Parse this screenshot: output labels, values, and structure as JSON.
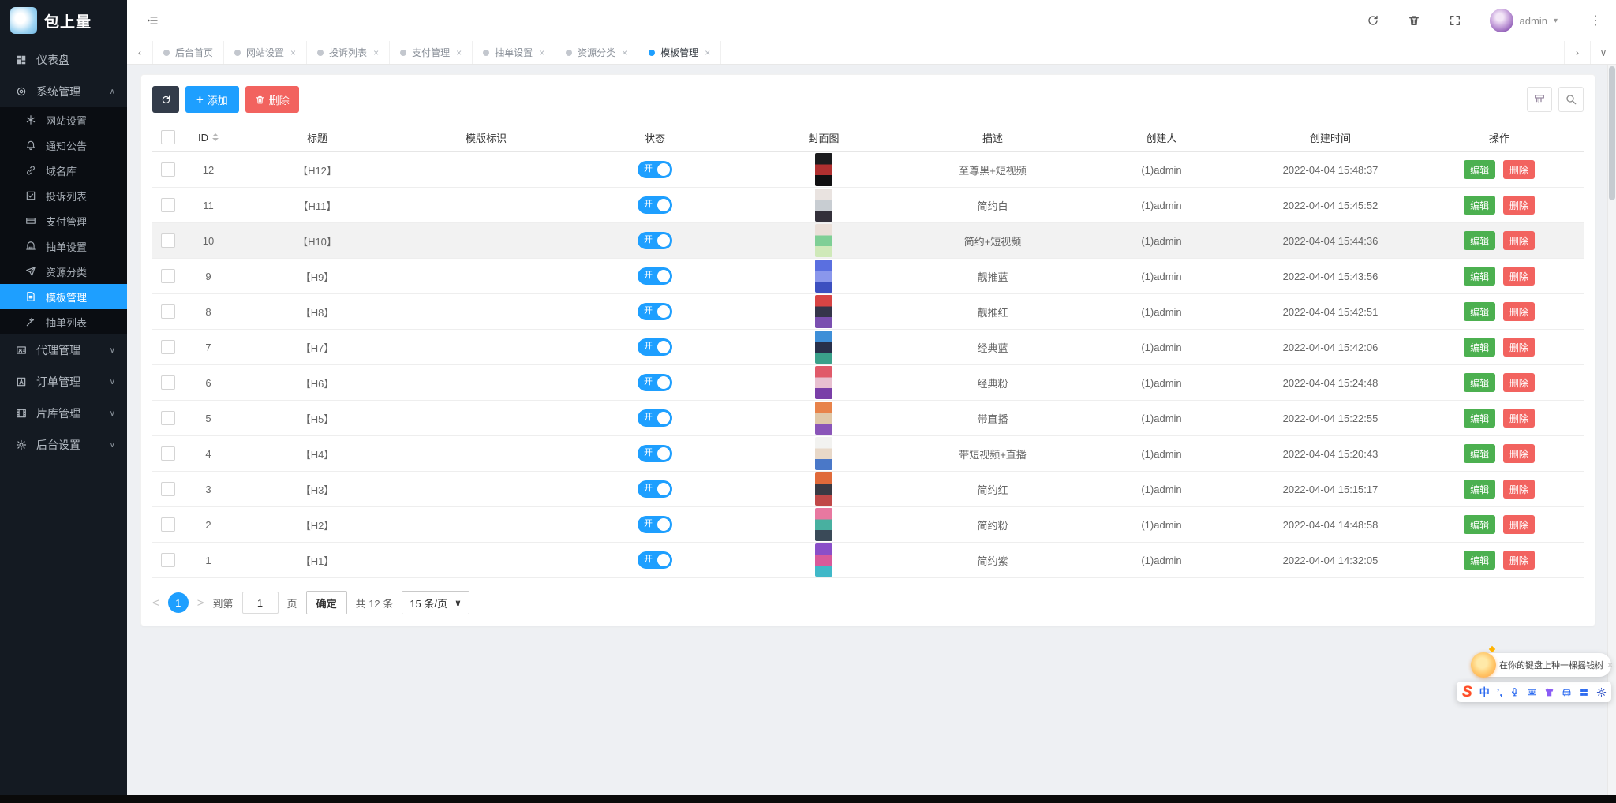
{
  "app": {
    "title": "包上量"
  },
  "topbar": {
    "username": "admin",
    "caret": "▾",
    "dots": "⋮"
  },
  "tabbar": {
    "prev": "‹",
    "next": "›",
    "collapse": "∨",
    "close_glyph": "×",
    "tabs": [
      {
        "label": "后台首页",
        "closable": false,
        "active": false
      },
      {
        "label": "网站设置",
        "closable": true,
        "active": false
      },
      {
        "label": "投诉列表",
        "closable": true,
        "active": false
      },
      {
        "label": "支付管理",
        "closable": true,
        "active": false
      },
      {
        "label": "抽单设置",
        "closable": true,
        "active": false
      },
      {
        "label": "资源分类",
        "closable": true,
        "active": false
      },
      {
        "label": "模板管理",
        "closable": true,
        "active": true
      }
    ]
  },
  "sidebar": {
    "items": [
      {
        "name": "dashboard",
        "label": "仪表盘",
        "icon": "dashboard",
        "type": "top"
      },
      {
        "name": "system-management",
        "label": "系统管理",
        "icon": "system",
        "type": "top",
        "chevron": "∧"
      },
      {
        "name": "website-settings",
        "label": "网站设置",
        "icon": "website",
        "type": "sub"
      },
      {
        "name": "notice",
        "label": "通知公告",
        "icon": "bell",
        "type": "sub"
      },
      {
        "name": "domain-library",
        "label": "域名库",
        "icon": "link",
        "type": "sub"
      },
      {
        "name": "complaint-list",
        "label": "投诉列表",
        "icon": "complaint",
        "type": "sub"
      },
      {
        "name": "payment-management",
        "label": "支付管理",
        "icon": "payment",
        "type": "sub"
      },
      {
        "name": "draw-settings",
        "label": "抽单设置",
        "icon": "draw",
        "type": "sub"
      },
      {
        "name": "resource-category",
        "label": "资源分类",
        "icon": "resource",
        "type": "sub"
      },
      {
        "name": "template-management",
        "label": "模板管理",
        "icon": "template",
        "type": "sub",
        "active": true
      },
      {
        "name": "draw-list",
        "label": "抽单列表",
        "icon": "wand",
        "type": "sub"
      },
      {
        "name": "agent-management",
        "label": "代理管理",
        "icon": "agent",
        "type": "top",
        "chevron": "∨"
      },
      {
        "name": "order-management",
        "label": "订单管理",
        "icon": "order",
        "type": "top",
        "chevron": "∨"
      },
      {
        "name": "media-library",
        "label": "片库管理",
        "icon": "film",
        "type": "top",
        "chevron": "∨"
      },
      {
        "name": "backend-settings",
        "label": "后台设置",
        "icon": "gears",
        "type": "top",
        "chevron": "∨"
      }
    ]
  },
  "toolbar": {
    "add_plus": "+",
    "add_label": "添加",
    "delete_label": "删除"
  },
  "table": {
    "columns": [
      "",
      "ID",
      "标题",
      "模版标识",
      "状态",
      "封面图",
      "描述",
      "创建人",
      "创建时间",
      "操作"
    ],
    "actions": {
      "edit": "编辑",
      "delete": "删除"
    },
    "rows": [
      {
        "id": "12",
        "title": "【H12】",
        "template_key": "",
        "status": "开",
        "desc": "至尊黑+短视频",
        "creator": "(1)admin",
        "created": "2022-04-04 15:48:37",
        "cover": [
          "#1c1c1e",
          "#b03030",
          "#101012"
        ],
        "highlighted": false
      },
      {
        "id": "11",
        "title": "【H11】",
        "template_key": "",
        "status": "开",
        "desc": "简约白",
        "creator": "(1)admin",
        "created": "2022-04-04 15:45:52",
        "cover": [
          "#e9e3e0",
          "#c8cdd2",
          "#33303a"
        ],
        "highlighted": false
      },
      {
        "id": "10",
        "title": "【H10】",
        "template_key": "",
        "status": "开",
        "desc": "简约+短视频",
        "creator": "(1)admin",
        "created": "2022-04-04 15:44:36",
        "cover": [
          "#eadfd8",
          "#7fcf96",
          "#cfe9b9"
        ],
        "highlighted": true
      },
      {
        "id": "9",
        "title": "【H9】",
        "template_key": "",
        "status": "开",
        "desc": "靓推蓝",
        "creator": "(1)admin",
        "created": "2022-04-04 15:43:56",
        "cover": [
          "#5a6fe0",
          "#8a97ec",
          "#3c4fc0"
        ],
        "highlighted": false
      },
      {
        "id": "8",
        "title": "【H8】",
        "template_key": "",
        "status": "开",
        "desc": "靓推红",
        "creator": "(1)admin",
        "created": "2022-04-04 15:42:51",
        "cover": [
          "#d84444",
          "#35354a",
          "#7a4fb0"
        ],
        "highlighted": false
      },
      {
        "id": "7",
        "title": "【H7】",
        "template_key": "",
        "status": "开",
        "desc": "经典蓝",
        "creator": "(1)admin",
        "created": "2022-04-04 15:42:06",
        "cover": [
          "#3e8fd8",
          "#28304a",
          "#3aa08a"
        ],
        "highlighted": false
      },
      {
        "id": "6",
        "title": "【H6】",
        "template_key": "",
        "status": "开",
        "desc": "经典粉",
        "creator": "(1)admin",
        "created": "2022-04-04 15:24:48",
        "cover": [
          "#e05a6a",
          "#e8c0d0",
          "#7a3fa8"
        ],
        "highlighted": false
      },
      {
        "id": "5",
        "title": "【H5】",
        "template_key": "",
        "status": "开",
        "desc": "带直播",
        "creator": "(1)admin",
        "created": "2022-04-04 15:22:55",
        "cover": [
          "#e8834a",
          "#e0c8a8",
          "#8a55b8"
        ],
        "highlighted": false
      },
      {
        "id": "4",
        "title": "【H4】",
        "template_key": "",
        "status": "开",
        "desc": "带短视频+直播",
        "creator": "(1)admin",
        "created": "2022-04-04 15:20:43",
        "cover": [
          "#f2f2f0",
          "#e8d8c8",
          "#4a78c8"
        ],
        "highlighted": false
      },
      {
        "id": "3",
        "title": "【H3】",
        "template_key": "",
        "status": "开",
        "desc": "简约红",
        "creator": "(1)admin",
        "created": "2022-04-04 15:15:17",
        "cover": [
          "#e06a3a",
          "#3a3a44",
          "#c04848"
        ],
        "highlighted": false
      },
      {
        "id": "2",
        "title": "【H2】",
        "template_key": "",
        "status": "开",
        "desc": "简约粉",
        "creator": "(1)admin",
        "created": "2022-04-04 14:48:58",
        "cover": [
          "#e878a0",
          "#48b0a0",
          "#3a4a58"
        ],
        "highlighted": false
      },
      {
        "id": "1",
        "title": "【H1】",
        "template_key": "",
        "status": "开",
        "desc": "简约紫",
        "creator": "(1)admin",
        "created": "2022-04-04 14:32:05",
        "cover": [
          "#8a4fc8",
          "#d85a9a",
          "#40b8c8"
        ],
        "highlighted": false
      }
    ]
  },
  "pagination": {
    "prev": "<",
    "current": "1",
    "next": ">",
    "goto_prefix": "到第",
    "goto_value": "1",
    "goto_suffix": "页",
    "confirm": "确定",
    "total": "共 12 条",
    "page_size": "15 条/页",
    "caret": "∨"
  },
  "ime": {
    "tooltip": "在你的键盘上种一棵摇钱树",
    "close": "×",
    "logo": "S",
    "lang": "中",
    "punct": "’,"
  },
  "colors": {
    "accent": "#1e9fff",
    "danger": "#f2635f",
    "success": "#4cb050",
    "dark_button": "#333c4a"
  }
}
